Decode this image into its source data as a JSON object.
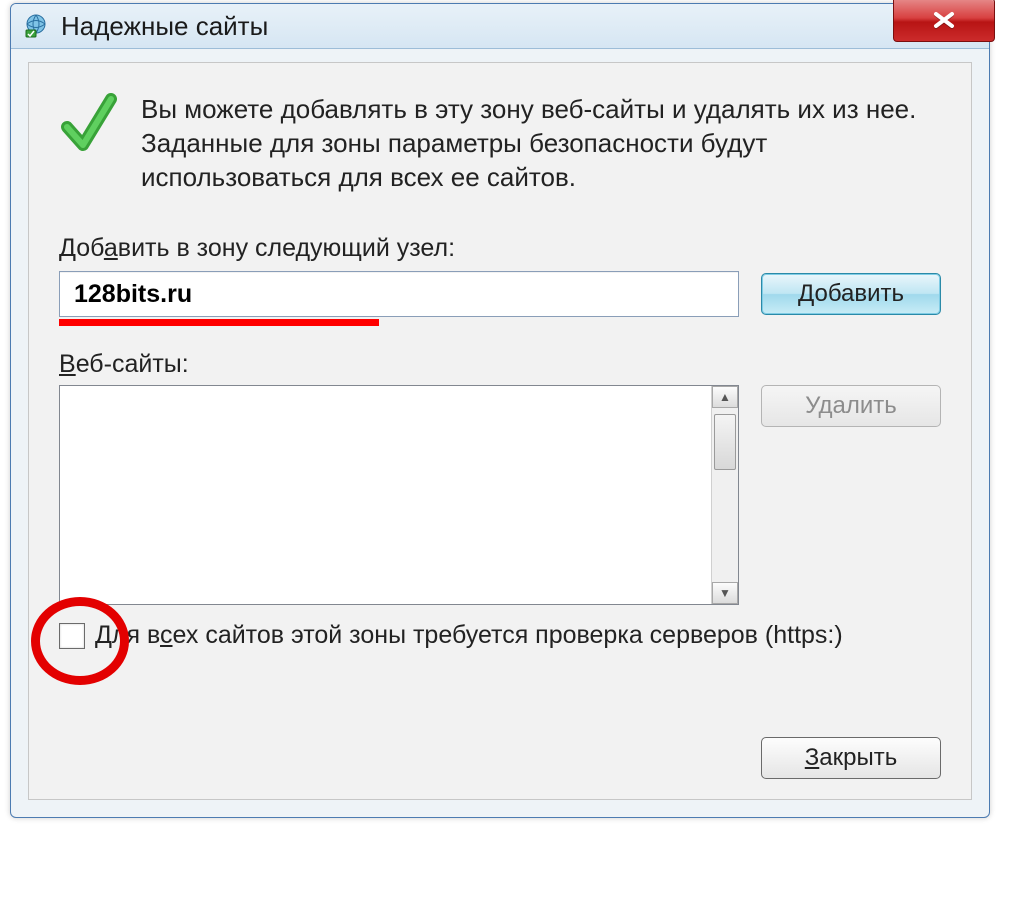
{
  "window": {
    "title": "Надежные сайты"
  },
  "intro": {
    "text": "Вы можете добавлять в эту зону веб-сайты и удалять их из нее. Заданные для зоны параметры безопасности будут использоваться для всех ее сайтов."
  },
  "addField": {
    "label_pre": "Доб",
    "label_u": "а",
    "label_post": "вить в зону следующий узел:",
    "value": "128bits.ru",
    "button": "Добавить"
  },
  "sitesList": {
    "label_u": "В",
    "label_post": "еб-сайты:",
    "removeButton": "Удалить"
  },
  "checkbox": {
    "label_pre": "Для в",
    "label_u": "с",
    "label_post": "ех сайтов этой зоны требуется проверка серверов (https:)",
    "checked": false
  },
  "footer": {
    "close_u": "З",
    "close_post": "акрыть"
  }
}
